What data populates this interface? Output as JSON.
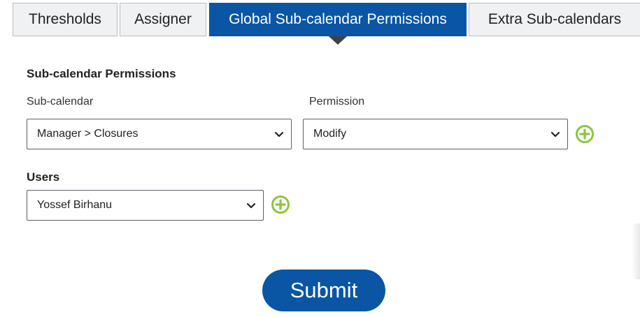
{
  "tabs": [
    {
      "label": "Thresholds",
      "active": false
    },
    {
      "label": "Assigner",
      "active": false
    },
    {
      "label": "Global Sub-calendar Permissions",
      "active": true
    },
    {
      "label": "Extra Sub-calendars",
      "active": false
    }
  ],
  "permissions": {
    "section_title": "Sub-calendar Permissions",
    "subcalendar_label": "Sub-calendar",
    "subcalendar_value": "Manager > Closures",
    "permission_label": "Permission",
    "permission_value": "Modify"
  },
  "users": {
    "label": "Users",
    "value": "Yossef Birhanu"
  },
  "submit_label": "Submit",
  "colors": {
    "primary": "#0a56a5",
    "add_icon": "#8cc63f",
    "tab_inactive": "#f0f1f3"
  },
  "icons": [
    "chevron-down-icon",
    "add-circle-icon"
  ]
}
